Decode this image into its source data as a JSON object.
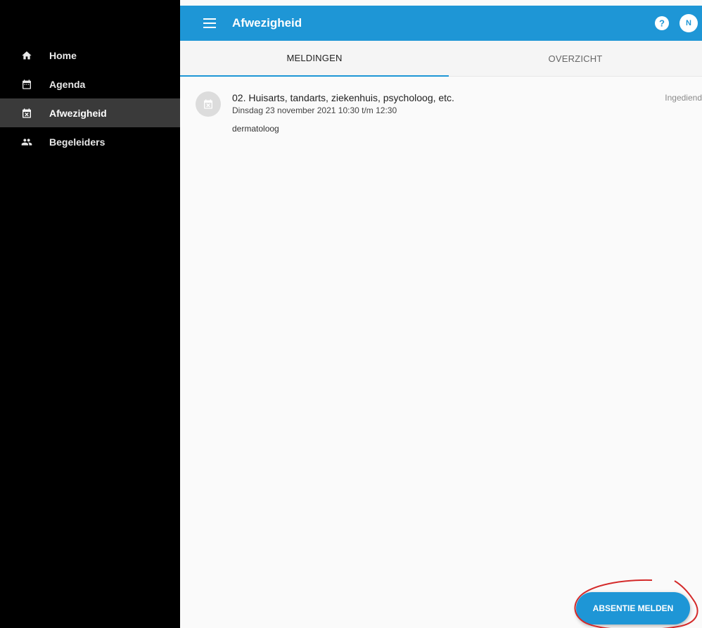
{
  "header": {
    "title": "Afwezigheid",
    "avatar_initial": "N"
  },
  "sidebar": {
    "items": [
      {
        "label": "Home",
        "icon": "home-icon",
        "active": false
      },
      {
        "label": "Agenda",
        "icon": "calendar-icon",
        "active": false
      },
      {
        "label": "Afwezigheid",
        "icon": "calendar-remove-icon",
        "active": true
      },
      {
        "label": "Begeleiders",
        "icon": "people-icon",
        "active": false
      }
    ]
  },
  "tabs": [
    {
      "label": "MELDINGEN",
      "active": true
    },
    {
      "label": "OVERZICHT",
      "active": false
    }
  ],
  "absences": [
    {
      "title": "02. Huisarts, tandarts, ziekenhuis, psycholoog, etc.",
      "date": "Dinsdag 23 november 2021 10:30 t/m 12:30",
      "note": "dermatoloog",
      "status": "Ingediend"
    }
  ],
  "fab": {
    "label": "ABSENTIE MELDEN"
  },
  "colors": {
    "primary": "#1e96d6",
    "sidebar_bg": "#000000",
    "sidebar_active": "#3a3a3a",
    "annotation": "#d42a2a"
  }
}
